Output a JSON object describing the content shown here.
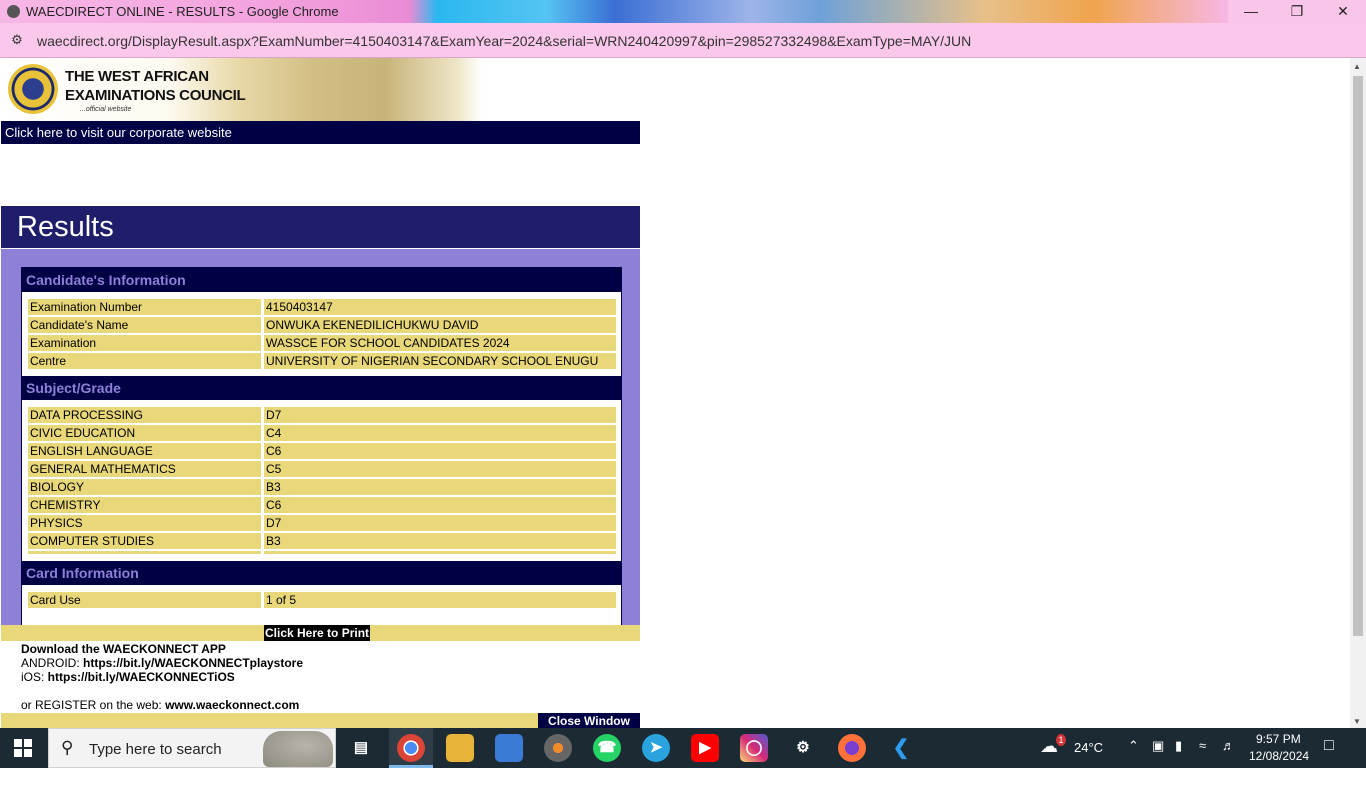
{
  "window": {
    "title": "WAECDIRECT ONLINE - RESULTS - Google Chrome",
    "minimize_glyph": "—",
    "restore_glyph": "❐",
    "close_glyph": "✕"
  },
  "address_bar": {
    "url": "waecdirect.org/DisplayResult.aspx?ExamNumber=4150403147&ExamYear=2024&serial=WRN240420997&pin=298527332498&ExamType=MAY/JUN"
  },
  "header": {
    "logo_line1": "THE WEST AFRICAN",
    "logo_line2": "EXAMINATIONS COUNCIL",
    "logo_tagline": "...official website",
    "corporate_link": "Click here to visit our corporate website"
  },
  "results": {
    "title": "Results",
    "candidate_section": "Candidate's Information",
    "candidate_info": [
      {
        "label": "Examination Number",
        "value": "4150403147"
      },
      {
        "label": "Candidate's Name",
        "value": "ONWUKA EKENEDILICHUKWU DAVID"
      },
      {
        "label": "Examination",
        "value": "WASSCE FOR SCHOOL CANDIDATES 2024"
      },
      {
        "label": "Centre",
        "value": "UNIVERSITY OF NIGERIAN SECONDARY SCHOOL ENUGU"
      }
    ],
    "subject_section": "Subject/Grade",
    "subjects": [
      {
        "subject": "DATA PROCESSING",
        "grade": "D7"
      },
      {
        "subject": "CIVIC EDUCATION",
        "grade": "C4"
      },
      {
        "subject": "ENGLISH LANGUAGE",
        "grade": "C6"
      },
      {
        "subject": "GENERAL MATHEMATICS",
        "grade": "C5"
      },
      {
        "subject": "BIOLOGY",
        "grade": "B3"
      },
      {
        "subject": "CHEMISTRY",
        "grade": "C6"
      },
      {
        "subject": "PHYSICS",
        "grade": "D7"
      },
      {
        "subject": "COMPUTER STUDIES",
        "grade": "B3"
      }
    ],
    "card_section": "Card Information",
    "card_info": [
      {
        "label": "Card Use",
        "value": "1 of 5"
      }
    ],
    "print_button": "Click Here to Print"
  },
  "download": {
    "heading": "Download the WAECKONNECT APP",
    "android_label": "ANDROID: ",
    "android_link": "https://bit.ly/WAECKONNECTplaystore",
    "ios_label": "iOS: ",
    "ios_link": "https://bit.ly/WAECKONNECTiOS",
    "register_label": "or REGISTER on the web: ",
    "register_link": "www.waeckonnect.com",
    "close_button": "Close Window"
  },
  "taskbar": {
    "search_placeholder": "Type here to search",
    "weather_temp": "24°C",
    "weather_badge": "1",
    "time": "9:57 PM",
    "date": "12/08/2024"
  },
  "colors": {
    "navy": "#000044",
    "results_header": "#1e1e6a",
    "lavender": "#8e80d6",
    "gold_row": "#e9d87a"
  }
}
